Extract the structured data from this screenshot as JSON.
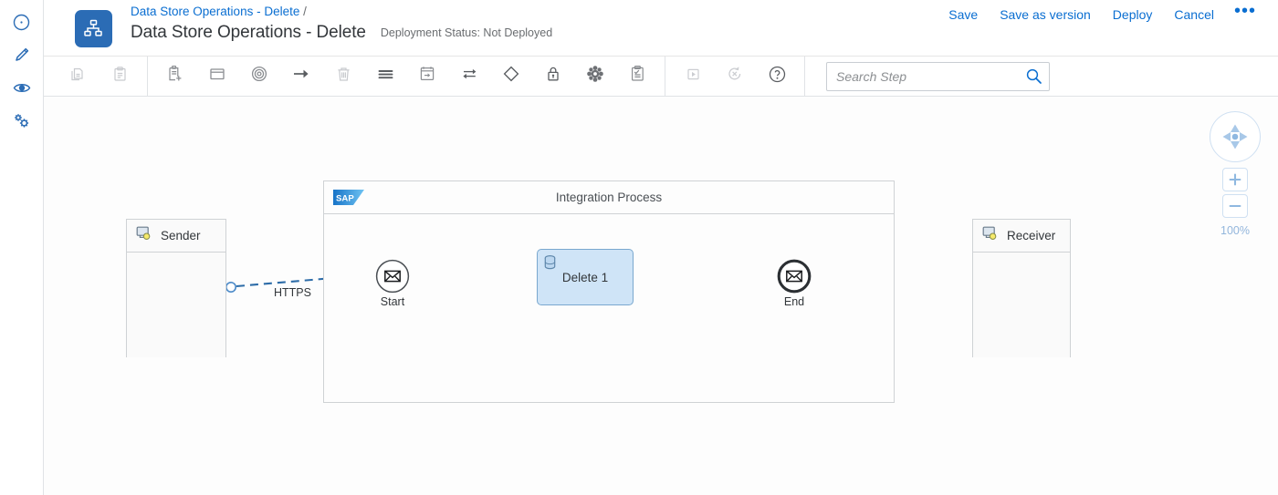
{
  "colors": {
    "brand_blue": "#0a6ed1",
    "app_icon_bg": "#2b6cb5",
    "task_fill": "#cfe4f7",
    "task_border": "#7aa8cf",
    "connector_blue": "#4a89c8",
    "text_dark": "#32363a",
    "text_muted": "#6a6d70",
    "zoom_label": "#93b6dc",
    "sap_logo_blue": "#1874c8"
  },
  "rail": {
    "items": [
      {
        "name": "explore-icon",
        "label": "Explore"
      },
      {
        "name": "edit-icon",
        "label": "Edit"
      },
      {
        "name": "view-icon",
        "label": "View"
      },
      {
        "name": "configure-icon",
        "label": "Configure"
      }
    ]
  },
  "header": {
    "app_icon_name": "integration-flow-icon",
    "breadcrumb_link": "Data Store Operations - Delete",
    "breadcrumb_separator": "/",
    "title": "Data Store Operations - Delete",
    "deployment_status": "Deployment Status: Not Deployed",
    "actions": [
      {
        "label": "Save",
        "name": "save-button"
      },
      {
        "label": "Save as version",
        "name": "save-as-version-button"
      },
      {
        "label": "Deploy",
        "name": "deploy-button"
      },
      {
        "label": "Cancel",
        "name": "cancel-button"
      }
    ],
    "overflow_label": "•••"
  },
  "toolbar": {
    "groups": [
      {
        "items": [
          {
            "icon": "copy-icon",
            "label": "Copy",
            "disabled": true
          },
          {
            "icon": "paste-icon",
            "label": "Paste",
            "disabled": true
          }
        ]
      },
      {
        "items": [
          {
            "icon": "add-task-icon",
            "label": "Add Step",
            "disabled": false
          },
          {
            "icon": "participant-icon",
            "label": "Participant",
            "disabled": false
          },
          {
            "icon": "event-icon",
            "label": "Event",
            "disabled": false
          },
          {
            "icon": "arrow-right-icon",
            "label": "Connector",
            "disabled": false
          },
          {
            "icon": "delete-icon",
            "label": "Delete",
            "disabled": true
          },
          {
            "icon": "list-icon",
            "label": "Process",
            "disabled": false
          },
          {
            "icon": "message-mapping-icon",
            "label": "Mapping",
            "disabled": false
          },
          {
            "icon": "exchange-icon",
            "label": "Exchange",
            "disabled": false
          },
          {
            "icon": "gateway-icon",
            "label": "Gateway",
            "disabled": false
          },
          {
            "icon": "lock-icon",
            "label": "Security",
            "disabled": false
          },
          {
            "icon": "gear-cluster-icon",
            "label": "Settings",
            "disabled": false
          },
          {
            "icon": "validate-icon",
            "label": "Validate",
            "disabled": false
          }
        ]
      },
      {
        "items": [
          {
            "icon": "run-icon",
            "label": "Run",
            "disabled": true
          },
          {
            "icon": "revert-icon",
            "label": "Revert",
            "disabled": true
          },
          {
            "icon": "help-icon",
            "label": "Help",
            "disabled": false
          }
        ]
      }
    ],
    "search": {
      "placeholder": "Search Step",
      "value": "",
      "icon": "search-icon"
    }
  },
  "diagram": {
    "sender": {
      "label": "Sender",
      "icon": "participant-system-icon"
    },
    "receiver": {
      "label": "Receiver",
      "icon": "participant-system-icon"
    },
    "pool": {
      "title": "Integration Process",
      "logo": "sap-logo",
      "logo_text": "SAP"
    },
    "nodes": [
      {
        "id": "start",
        "label": "Start",
        "type": "message-start-event",
        "icon": "envelope-icon"
      },
      {
        "id": "delete-1",
        "label": "Delete 1",
        "type": "data-store-task",
        "icon": "database-icon"
      },
      {
        "id": "end",
        "label": "End",
        "type": "message-end-event",
        "icon": "envelope-icon"
      }
    ],
    "edges": [
      {
        "from": "sender",
        "to": "start",
        "label": "HTTPS",
        "style": "dashed"
      },
      {
        "from": "start",
        "to": "delete-1",
        "label": "",
        "style": "solid"
      },
      {
        "from": "delete-1",
        "to": "end",
        "label": "",
        "style": "solid"
      }
    ]
  },
  "zoom_controls": {
    "pan_icon": "pan-control-icon",
    "zoom_in_label": "+",
    "zoom_out_label": "−",
    "level": "100%"
  }
}
